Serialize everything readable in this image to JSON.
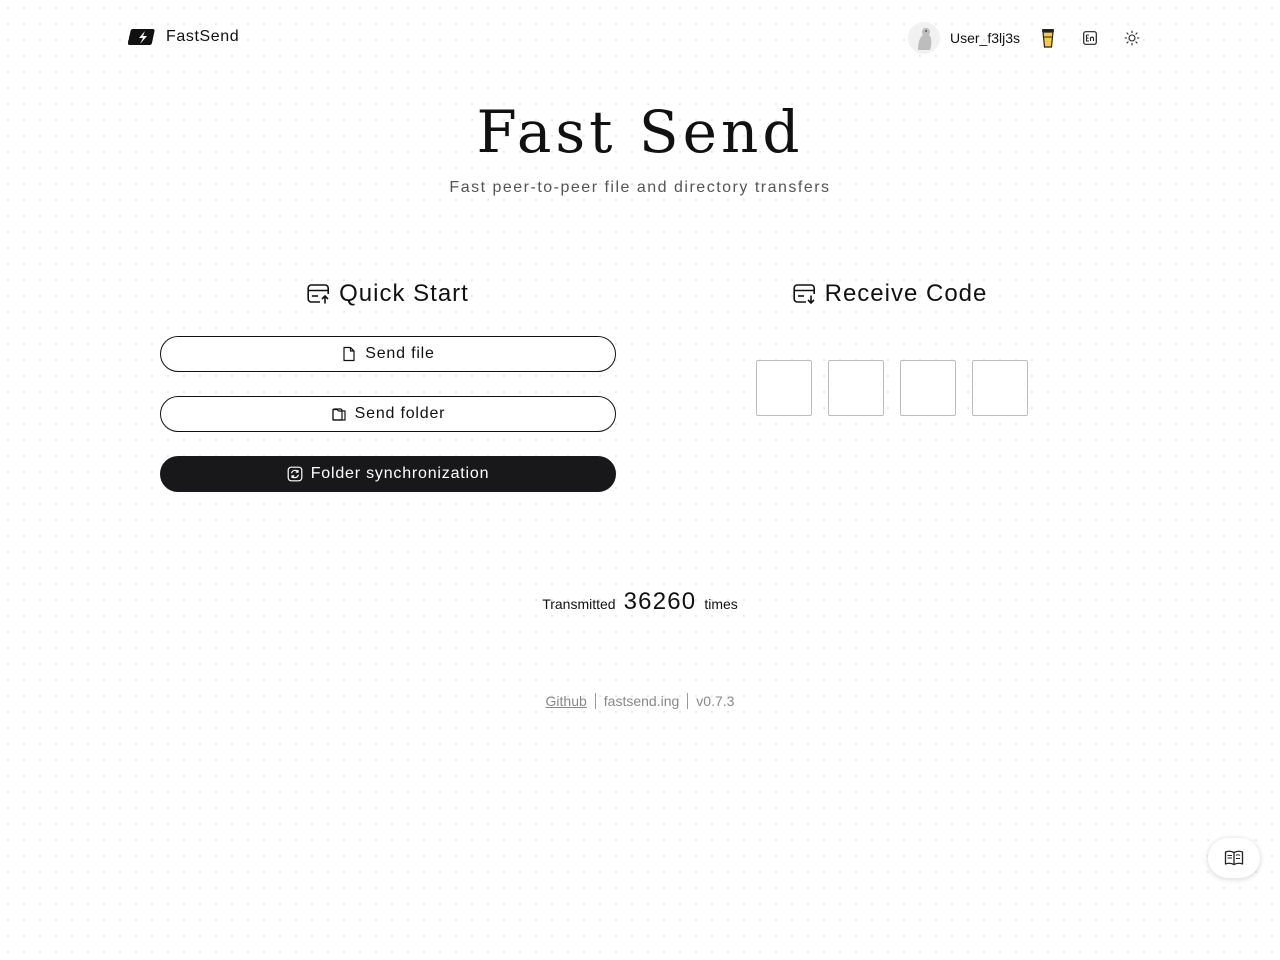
{
  "header": {
    "brand": "FastSend",
    "user_name": "User_f3lj3s",
    "icons": [
      "logo-icon",
      "coffee-cup-icon",
      "language-en-icon",
      "theme-sun-icon"
    ]
  },
  "hero": {
    "title": "Fast Send",
    "subtitle": "Fast peer-to-peer file and directory transfers"
  },
  "quick_start": {
    "title": "Quick Start",
    "buttons": [
      {
        "label": "Send file",
        "icon": "file-icon"
      },
      {
        "label": "Send folder",
        "icon": "folder-icon"
      },
      {
        "label": "Folder synchronization",
        "icon": "sync-icon"
      }
    ]
  },
  "receive": {
    "title": "Receive Code",
    "codes": [
      "",
      "",
      "",
      ""
    ]
  },
  "stats": {
    "prefix": "Transmitted",
    "count": "36260",
    "suffix": "times"
  },
  "footer": {
    "github": "Github",
    "domain": "fastsend.ing",
    "version": "v0.7.3"
  },
  "colors": {
    "accent_dark": "#18181b",
    "muted": "#888888"
  }
}
